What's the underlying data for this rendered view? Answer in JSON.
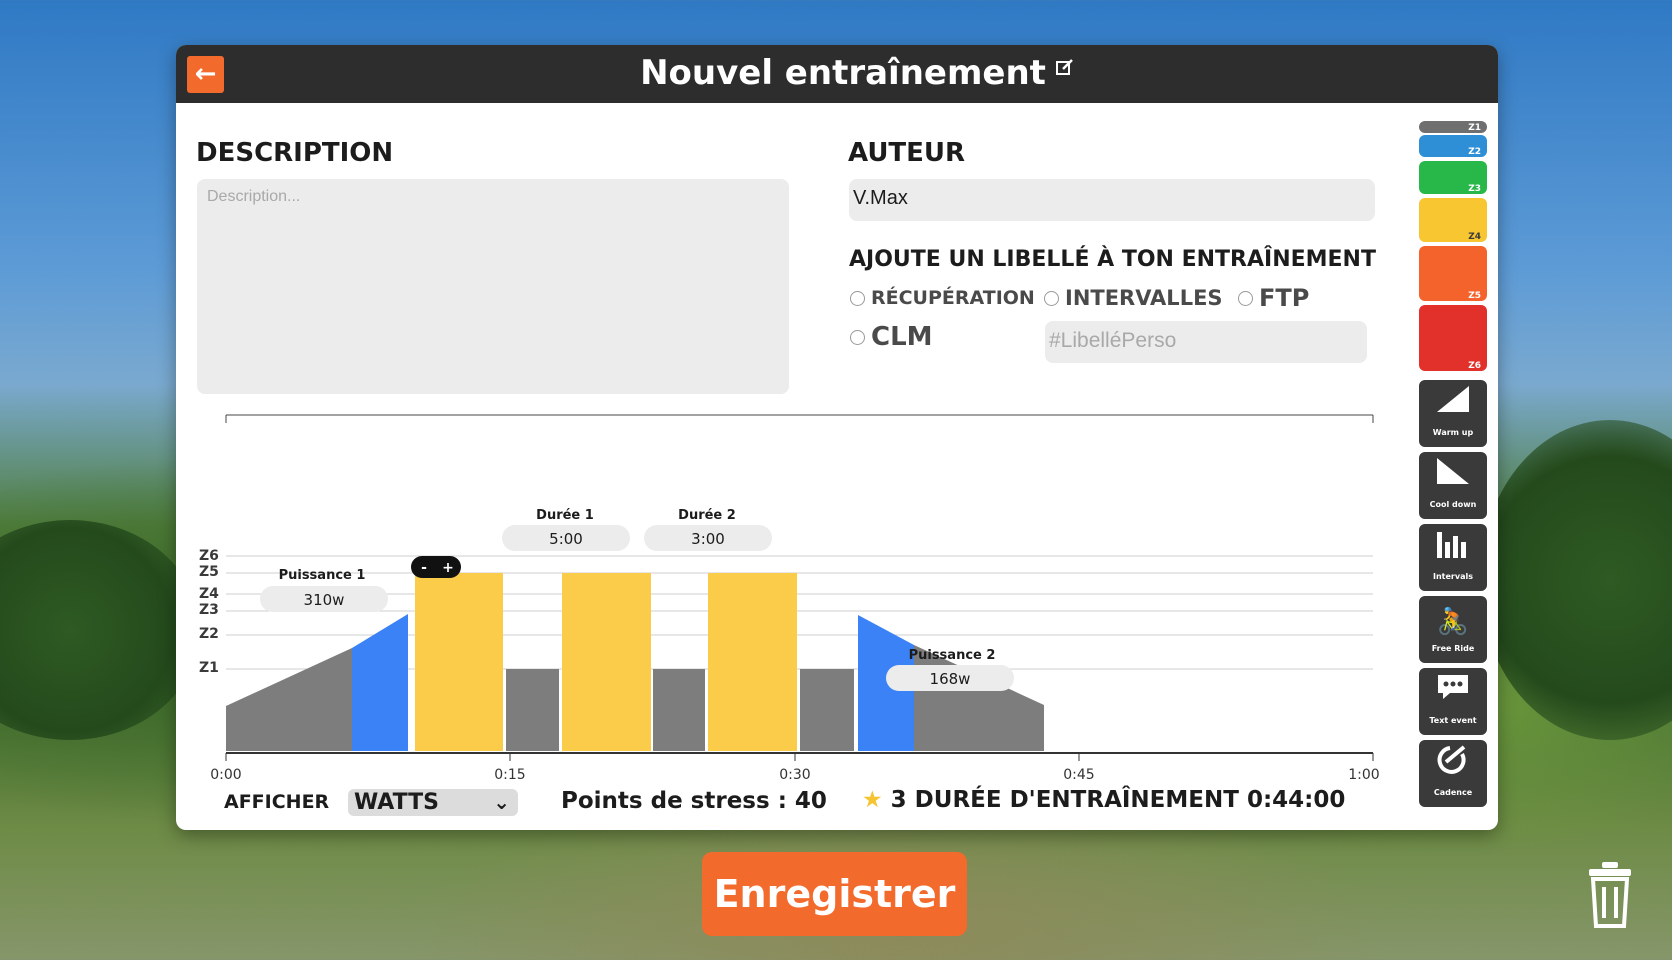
{
  "window": {
    "title": "Nouvel entraînement",
    "back_icon": "arrow-left-icon",
    "edit_icon": "edit-icon"
  },
  "description": {
    "heading": "DESCRIPTION",
    "placeholder": "Description..."
  },
  "author": {
    "heading": "AUTEUR",
    "value": "V.Max"
  },
  "tags": {
    "heading": "AJOUTE UN LIBELLÉ À TON ENTRAÎNEMENT",
    "options": [
      "RÉCUPÉRATION",
      "INTERVALLES",
      "FTP",
      "CLM"
    ],
    "custom_placeholder": "#LibelléPerso"
  },
  "chart_data": {
    "type": "bar",
    "x_ticks": [
      "0:00",
      "0:15",
      "0:30",
      "0:45",
      "1:00"
    ],
    "zone_labels": [
      "Z6",
      "Z5",
      "Z4",
      "Z3",
      "Z2",
      "Z1"
    ],
    "segments": [
      {
        "kind": "warmup",
        "zone": "gray"
      },
      {
        "kind": "warmup",
        "zone": "blue"
      },
      {
        "kind": "steady",
        "zone": "yellow"
      },
      {
        "kind": "steady",
        "zone": "gray"
      },
      {
        "kind": "steady",
        "zone": "yellow"
      },
      {
        "kind": "steady",
        "zone": "gray"
      },
      {
        "kind": "steady",
        "zone": "yellow"
      },
      {
        "kind": "steady",
        "zone": "gray"
      },
      {
        "kind": "cooldown",
        "zone": "blue"
      },
      {
        "kind": "cooldown",
        "zone": "gray"
      }
    ],
    "callouts": {
      "power1_label": "Puissance 1",
      "power1_value": "310w",
      "duration1_label": "Durée 1",
      "duration1_value": "5:00",
      "duration2_label": "Durée 2",
      "duration2_value": "3:00",
      "power2_label": "Puissance 2",
      "power2_value": "168w",
      "stepper_minus": "-",
      "stepper_plus": "+"
    },
    "colors": {
      "gray": "#7d7d7d",
      "blue": "#3b82f6",
      "yellow": "#fbcb4a"
    }
  },
  "footer": {
    "show_label": "AFFICHER",
    "unit": "WATTS",
    "stress_label": "Points de stress :",
    "stress_value": "40",
    "rating": "3",
    "duration_label": "DURÉE D'ENTRAÎNEMENT",
    "duration_value": "0:44:00"
  },
  "zones": [
    {
      "label": "Z1",
      "color": "#6f6f6f"
    },
    {
      "label": "Z2",
      "color": "#2f8fd6"
    },
    {
      "label": "Z3",
      "color": "#28b84a"
    },
    {
      "label": "Z4",
      "color": "#f8c631"
    },
    {
      "label": "Z5",
      "color": "#f4632c"
    },
    {
      "label": "Z6",
      "color": "#e2312b"
    }
  ],
  "tools": [
    {
      "label": "Warm up",
      "icon": "warmup-icon"
    },
    {
      "label": "Cool down",
      "icon": "cooldown-icon"
    },
    {
      "label": "Intervals",
      "icon": "intervals-icon"
    },
    {
      "label": "Free Ride",
      "icon": "cyclist-icon"
    },
    {
      "label": "Text event",
      "icon": "chat-icon"
    },
    {
      "label": "Cadence",
      "icon": "cadence-icon"
    }
  ],
  "save_button": "Enregistrer",
  "trash_icon": "trash-icon"
}
